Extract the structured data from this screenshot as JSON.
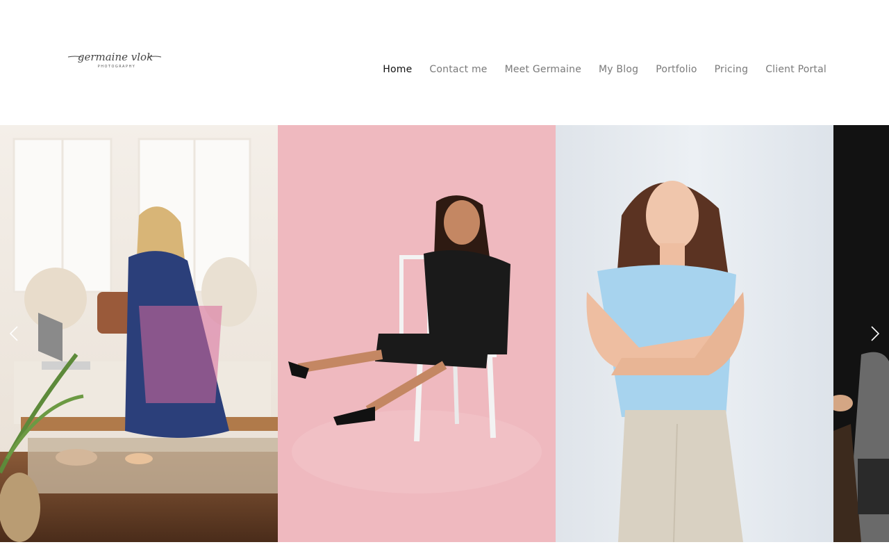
{
  "logo": {
    "text": "germaine vlok",
    "subtext": "PHOTOGRAPHY"
  },
  "nav": {
    "items": [
      {
        "label": "Home",
        "active": true
      },
      {
        "label": "Contact me",
        "active": false
      },
      {
        "label": "Meet Germaine",
        "active": false
      },
      {
        "label": "My Blog",
        "active": false
      },
      {
        "label": "Portfolio",
        "active": false
      },
      {
        "label": "Pricing",
        "active": false
      },
      {
        "label": "Client Portal",
        "active": false
      }
    ]
  },
  "slider": {
    "slides": [
      {
        "subject": "woman in floral dress sitting on bed holding phone",
        "background": "bright living room"
      },
      {
        "subject": "woman in black dress sitting on white chair",
        "background": "pink backdrop"
      },
      {
        "subject": "woman in light blue top with crossed arms leaning on wall",
        "background": "light grey-blue wall"
      },
      {
        "subject": "man in grey suit seated",
        "background": "dark backdrop"
      }
    ],
    "prev_icon": "chevron-left-icon",
    "next_icon": "chevron-right-icon"
  },
  "colors": {
    "nav_active": "#111111",
    "nav_inactive": "#7a7a7a",
    "pink_backdrop": "#efb9bf",
    "blue_top": "#a7d3ee"
  }
}
